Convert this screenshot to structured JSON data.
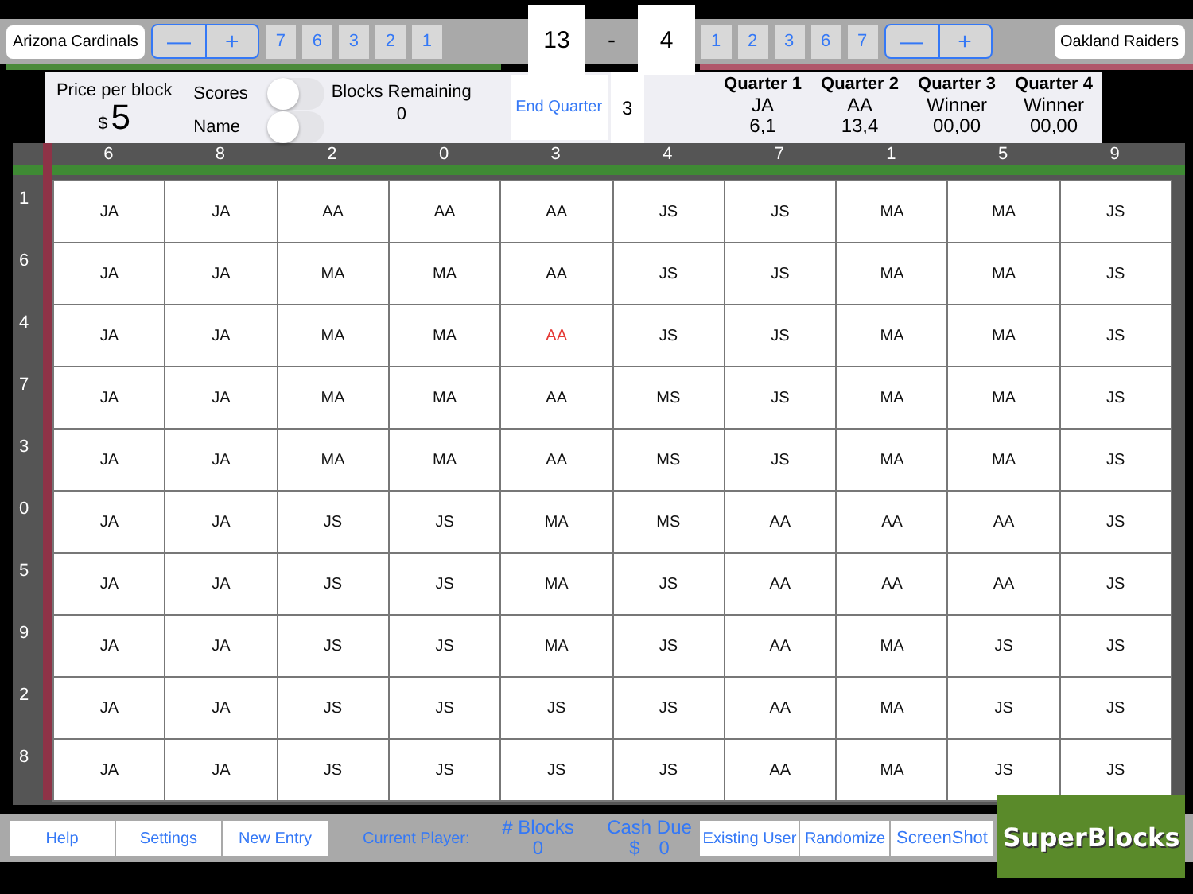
{
  "home_team": {
    "name": "Arizona Cardinals",
    "minus": "—",
    "plus": "+",
    "digits": [
      "7",
      "6",
      "3",
      "2",
      "1"
    ]
  },
  "score": {
    "home": "13",
    "separator": "-",
    "away": "4"
  },
  "away_team": {
    "name": "Oakland Raiders",
    "minus": "—",
    "plus": "+",
    "digits": [
      "1",
      "2",
      "3",
      "6",
      "7"
    ]
  },
  "info": {
    "price_label": "Price per block",
    "price_currency": "$",
    "price_value": "5",
    "toggles": [
      {
        "label": "Scores",
        "on": false
      },
      {
        "label": "Name",
        "on": false
      }
    ],
    "blocks_remaining_label": "Blocks Remaining",
    "blocks_remaining": "0",
    "end_quarter_button": "End Quarter",
    "quarter_number": "3",
    "quarters": [
      {
        "title": "Quarter 1",
        "winner": "JA",
        "score": "6,1"
      },
      {
        "title": "Quarter 2",
        "winner": "AA",
        "score": "13,4"
      },
      {
        "title": "Quarter 3",
        "winner": "Winner",
        "score": "00,00"
      },
      {
        "title": "Quarter 4",
        "winner": "Winner",
        "score": "00,00"
      }
    ]
  },
  "grid": {
    "columns": [
      "6",
      "8",
      "2",
      "0",
      "3",
      "4",
      "7",
      "1",
      "5",
      "9"
    ],
    "rows": [
      {
        "label": "1",
        "cells": [
          {
            "text": "JA",
            "highlight": false
          },
          {
            "text": "JA",
            "highlight": false
          },
          {
            "text": "AA",
            "highlight": false
          },
          {
            "text": "AA",
            "highlight": false
          },
          {
            "text": "AA",
            "highlight": false
          },
          {
            "text": "JS",
            "highlight": false
          },
          {
            "text": "JS",
            "highlight": false
          },
          {
            "text": "MA",
            "highlight": false
          },
          {
            "text": "MA",
            "highlight": false
          },
          {
            "text": "JS",
            "highlight": false
          }
        ]
      },
      {
        "label": "6",
        "cells": [
          {
            "text": "JA",
            "highlight": false
          },
          {
            "text": "JA",
            "highlight": false
          },
          {
            "text": "MA",
            "highlight": false
          },
          {
            "text": "MA",
            "highlight": false
          },
          {
            "text": "AA",
            "highlight": false
          },
          {
            "text": "JS",
            "highlight": false
          },
          {
            "text": "JS",
            "highlight": false
          },
          {
            "text": "MA",
            "highlight": false
          },
          {
            "text": "MA",
            "highlight": false
          },
          {
            "text": "JS",
            "highlight": false
          }
        ]
      },
      {
        "label": "4",
        "cells": [
          {
            "text": "JA",
            "highlight": false
          },
          {
            "text": "JA",
            "highlight": false
          },
          {
            "text": "MA",
            "highlight": false
          },
          {
            "text": "MA",
            "highlight": false
          },
          {
            "text": "AA",
            "highlight": true
          },
          {
            "text": "JS",
            "highlight": false
          },
          {
            "text": "JS",
            "highlight": false
          },
          {
            "text": "MA",
            "highlight": false
          },
          {
            "text": "MA",
            "highlight": false
          },
          {
            "text": "JS",
            "highlight": false
          }
        ]
      },
      {
        "label": "7",
        "cells": [
          {
            "text": "JA",
            "highlight": false
          },
          {
            "text": "JA",
            "highlight": false
          },
          {
            "text": "MA",
            "highlight": false
          },
          {
            "text": "MA",
            "highlight": false
          },
          {
            "text": "AA",
            "highlight": false
          },
          {
            "text": "MS",
            "highlight": false
          },
          {
            "text": "JS",
            "highlight": false
          },
          {
            "text": "MA",
            "highlight": false
          },
          {
            "text": "MA",
            "highlight": false
          },
          {
            "text": "JS",
            "highlight": false
          }
        ]
      },
      {
        "label": "3",
        "cells": [
          {
            "text": "JA",
            "highlight": false
          },
          {
            "text": "JA",
            "highlight": false
          },
          {
            "text": "MA",
            "highlight": false
          },
          {
            "text": "MA",
            "highlight": false
          },
          {
            "text": "AA",
            "highlight": false
          },
          {
            "text": "MS",
            "highlight": false
          },
          {
            "text": "JS",
            "highlight": false
          },
          {
            "text": "MA",
            "highlight": false
          },
          {
            "text": "MA",
            "highlight": false
          },
          {
            "text": "JS",
            "highlight": false
          }
        ]
      },
      {
        "label": "0",
        "cells": [
          {
            "text": "JA",
            "highlight": false
          },
          {
            "text": "JA",
            "highlight": false
          },
          {
            "text": "JS",
            "highlight": false
          },
          {
            "text": "JS",
            "highlight": false
          },
          {
            "text": "MA",
            "highlight": false
          },
          {
            "text": "MS",
            "highlight": false
          },
          {
            "text": "AA",
            "highlight": false
          },
          {
            "text": "AA",
            "highlight": false
          },
          {
            "text": "AA",
            "highlight": false
          },
          {
            "text": "JS",
            "highlight": false
          }
        ]
      },
      {
        "label": "5",
        "cells": [
          {
            "text": "JA",
            "highlight": false
          },
          {
            "text": "JA",
            "highlight": false
          },
          {
            "text": "JS",
            "highlight": false
          },
          {
            "text": "JS",
            "highlight": false
          },
          {
            "text": "MA",
            "highlight": false
          },
          {
            "text": "JS",
            "highlight": false
          },
          {
            "text": "AA",
            "highlight": false
          },
          {
            "text": "AA",
            "highlight": false
          },
          {
            "text": "AA",
            "highlight": false
          },
          {
            "text": "JS",
            "highlight": false
          }
        ]
      },
      {
        "label": "9",
        "cells": [
          {
            "text": "JA",
            "highlight": false
          },
          {
            "text": "JA",
            "highlight": false
          },
          {
            "text": "JS",
            "highlight": false
          },
          {
            "text": "JS",
            "highlight": false
          },
          {
            "text": "MA",
            "highlight": false
          },
          {
            "text": "JS",
            "highlight": false
          },
          {
            "text": "AA",
            "highlight": false
          },
          {
            "text": "MA",
            "highlight": false
          },
          {
            "text": "JS",
            "highlight": false
          },
          {
            "text": "JS",
            "highlight": false
          }
        ]
      },
      {
        "label": "2",
        "cells": [
          {
            "text": "JA",
            "highlight": false
          },
          {
            "text": "JA",
            "highlight": false
          },
          {
            "text": "JS",
            "highlight": false
          },
          {
            "text": "JS",
            "highlight": false
          },
          {
            "text": "JS",
            "highlight": false
          },
          {
            "text": "JS",
            "highlight": false
          },
          {
            "text": "AA",
            "highlight": false
          },
          {
            "text": "MA",
            "highlight": false
          },
          {
            "text": "JS",
            "highlight": false
          },
          {
            "text": "JS",
            "highlight": false
          }
        ]
      },
      {
        "label": "8",
        "cells": [
          {
            "text": "JA",
            "highlight": false
          },
          {
            "text": "JA",
            "highlight": false
          },
          {
            "text": "JS",
            "highlight": false
          },
          {
            "text": "JS",
            "highlight": false
          },
          {
            "text": "JS",
            "highlight": false
          },
          {
            "text": "JS",
            "highlight": false
          },
          {
            "text": "AA",
            "highlight": false
          },
          {
            "text": "MA",
            "highlight": false
          },
          {
            "text": "JS",
            "highlight": false
          },
          {
            "text": "JS",
            "highlight": false
          }
        ]
      }
    ]
  },
  "bottom_bar": {
    "left_buttons": [
      "Help",
      "Settings",
      "New Entry"
    ],
    "current_player_label": "Current Player:",
    "blocks": {
      "label": "# Blocks",
      "value": "0"
    },
    "cash_due": {
      "label": "Cash Due",
      "currency": "$",
      "value": "0"
    },
    "right_buttons": [
      "Existing User",
      "Randomize",
      "ScreenShot"
    ]
  },
  "logo": {
    "text": "SuperBlocks"
  }
}
